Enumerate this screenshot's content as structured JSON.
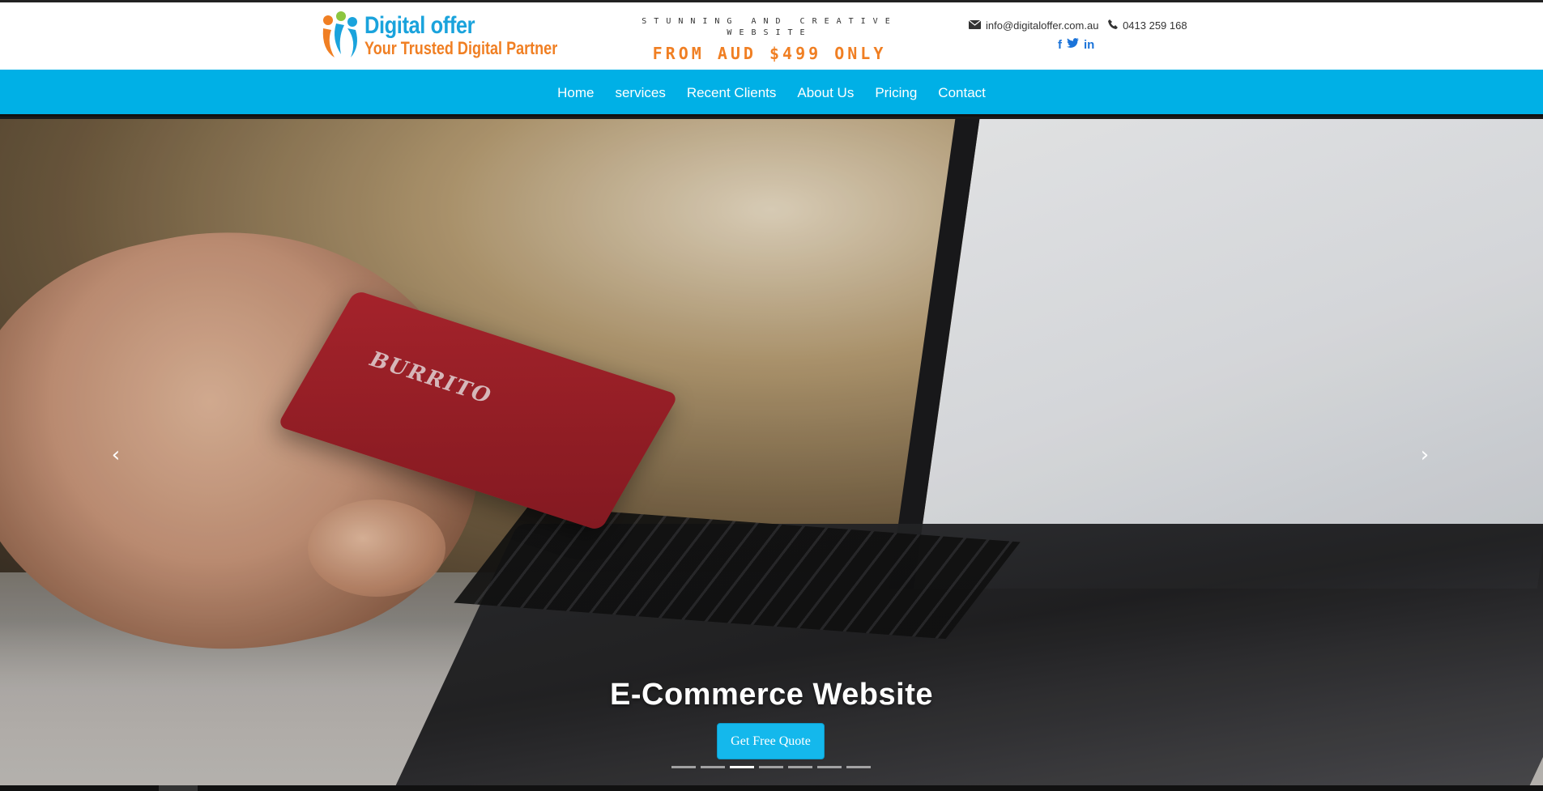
{
  "header": {
    "logo": {
      "title": "Digital offer",
      "tagline": "Your Trusted Digital Partner"
    },
    "promo": {
      "line1": "STUNNING AND CREATIVE WEBSITE",
      "line2": "FROM AUD $499 ONLY"
    },
    "contact": {
      "email": "info@digitaloffer.com.au",
      "phone": "0413 259 168"
    },
    "social": {
      "facebook": "f",
      "twitter": "twitter-icon",
      "linkedin": "in"
    }
  },
  "nav": {
    "items": [
      {
        "label": "Home"
      },
      {
        "label": "services"
      },
      {
        "label": "Recent Clients"
      },
      {
        "label": "About Us"
      },
      {
        "label": "Pricing"
      },
      {
        "label": "Contact"
      }
    ]
  },
  "hero": {
    "card_text": "BURRITO",
    "caption": "E-Commerce Website",
    "cta": "Get Free Quote",
    "prev_arrow": "‹",
    "next_arrow": "›",
    "slide_count": 7,
    "active_slide": 3
  },
  "colors": {
    "brand_blue": "#00b0e6",
    "brand_orange": "#f07f23",
    "button": "#14b8ec"
  }
}
